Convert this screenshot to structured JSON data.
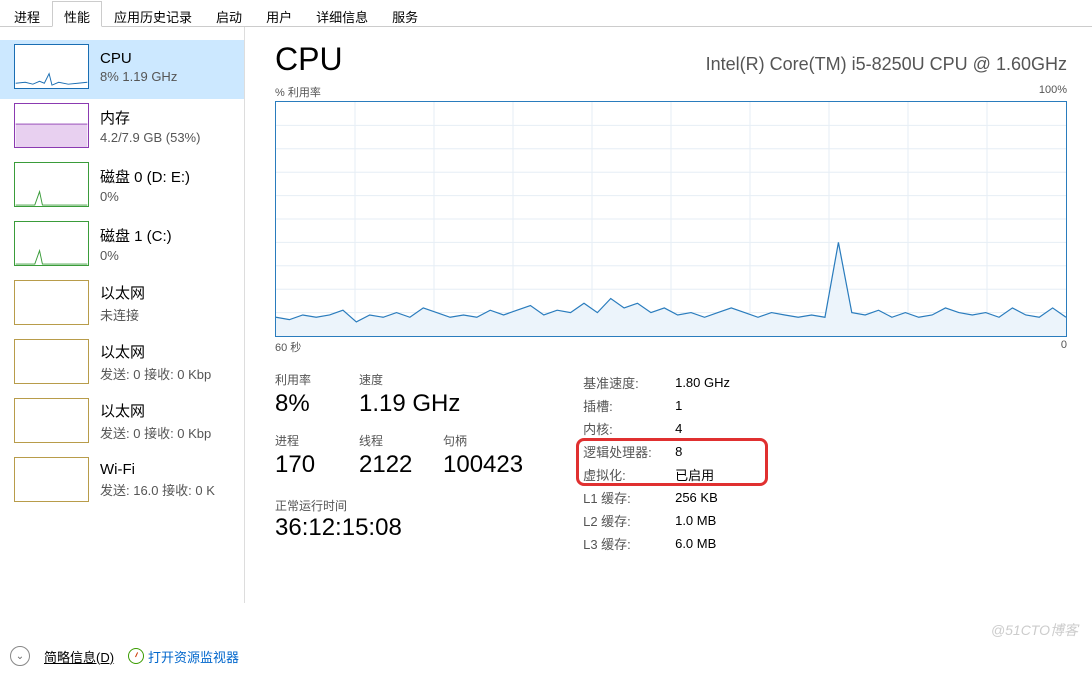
{
  "tabs": [
    "进程",
    "性能",
    "应用历史记录",
    "启动",
    "用户",
    "详细信息",
    "服务"
  ],
  "active_tab": 1,
  "sidebar": {
    "items": [
      {
        "title": "CPU",
        "sub": "8% 1.19 GHz",
        "type": "cpu"
      },
      {
        "title": "内存",
        "sub": "4.2/7.9 GB (53%)",
        "type": "mem"
      },
      {
        "title": "磁盘 0 (D: E:)",
        "sub": "0%",
        "type": "disk"
      },
      {
        "title": "磁盘 1 (C:)",
        "sub": "0%",
        "type": "disk"
      },
      {
        "title": "以太网",
        "sub": "未连接",
        "type": "eth"
      },
      {
        "title": "以太网",
        "sub": "发送: 0 接收: 0 Kbp",
        "type": "eth"
      },
      {
        "title": "以太网",
        "sub": "发送: 0 接收: 0 Kbp",
        "type": "eth"
      },
      {
        "title": "Wi-Fi",
        "sub": "发送: 16.0 接收: 0 K",
        "type": "eth"
      }
    ],
    "selected": 0
  },
  "header": {
    "title": "CPU",
    "model": "Intel(R) Core(TM) i5-8250U CPU @ 1.60GHz"
  },
  "chart": {
    "y_label": "% 利用率",
    "y_max": "100%",
    "x_left": "60 秒",
    "x_right": "0"
  },
  "chart_data": {
    "type": "line",
    "title": "% 利用率",
    "xlabel": "60 秒 → 0",
    "ylabel": "% 利用率",
    "ylim": [
      0,
      100
    ],
    "x": [
      0,
      1,
      2,
      3,
      4,
      5,
      6,
      7,
      8,
      9,
      10,
      11,
      12,
      13,
      14,
      15,
      16,
      17,
      18,
      19,
      20,
      21,
      22,
      23,
      24,
      25,
      26,
      27,
      28,
      29,
      30,
      31,
      32,
      33,
      34,
      35,
      36,
      37,
      38,
      39,
      40,
      41,
      42,
      43,
      44,
      45,
      46,
      47,
      48,
      49,
      50,
      51,
      52,
      53,
      54,
      55,
      56,
      57,
      58,
      59
    ],
    "values": [
      8,
      7,
      9,
      8,
      9,
      11,
      6,
      9,
      8,
      10,
      8,
      12,
      10,
      8,
      9,
      8,
      11,
      9,
      11,
      13,
      9,
      11,
      10,
      14,
      10,
      16,
      12,
      14,
      10,
      12,
      9,
      10,
      8,
      10,
      12,
      10,
      8,
      10,
      9,
      8,
      9,
      8,
      40,
      10,
      9,
      11,
      8,
      10,
      8,
      9,
      12,
      10,
      9,
      10,
      8,
      12,
      9,
      8,
      12,
      8
    ]
  },
  "stats": {
    "util_label": "利用率",
    "util_value": "8%",
    "speed_label": "速度",
    "speed_value": "1.19 GHz",
    "proc_label": "进程",
    "proc_value": "170",
    "thread_label": "线程",
    "thread_value": "2122",
    "handle_label": "句柄",
    "handle_value": "100423",
    "uptime_label": "正常运行时间",
    "uptime_value": "36:12:15:08"
  },
  "right_stats": [
    {
      "k": "基准速度:",
      "v": "1.80 GHz"
    },
    {
      "k": "插槽:",
      "v": "1"
    },
    {
      "k": "内核:",
      "v": "4"
    },
    {
      "k": "逻辑处理器:",
      "v": "8"
    },
    {
      "k": "虚拟化:",
      "v": "已启用"
    },
    {
      "k": "L1 缓存:",
      "v": "256 KB"
    },
    {
      "k": "L2 缓存:",
      "v": "1.0 MB"
    },
    {
      "k": "L3 缓存:",
      "v": "6.0 MB"
    }
  ],
  "bottom": {
    "brief": "简略信息(D)",
    "resmon": "打开资源监视器"
  },
  "watermark": "@51CTO博客"
}
